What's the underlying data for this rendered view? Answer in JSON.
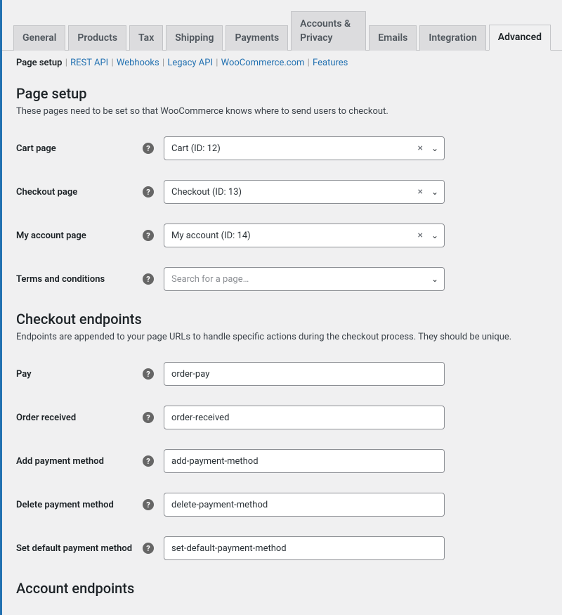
{
  "tabs": [
    {
      "label": "General",
      "active": false
    },
    {
      "label": "Products",
      "active": false
    },
    {
      "label": "Tax",
      "active": false
    },
    {
      "label": "Shipping",
      "active": false
    },
    {
      "label": "Payments",
      "active": false
    },
    {
      "label": "Accounts & Privacy",
      "active": false
    },
    {
      "label": "Emails",
      "active": false
    },
    {
      "label": "Integration",
      "active": false
    },
    {
      "label": "Advanced",
      "active": true
    }
  ],
  "subnav": [
    {
      "label": "Page setup",
      "current": true
    },
    {
      "label": "REST API",
      "current": false
    },
    {
      "label": "Webhooks",
      "current": false
    },
    {
      "label": "Legacy API",
      "current": false
    },
    {
      "label": "WooCommerce.com",
      "current": false
    },
    {
      "label": "Features",
      "current": false
    }
  ],
  "page_setup": {
    "heading": "Page setup",
    "description": "These pages need to be set so that WooCommerce knows where to send users to checkout.",
    "fields": {
      "cart": {
        "label": "Cart page",
        "value": "Cart (ID: 12)",
        "clearable": true
      },
      "checkout": {
        "label": "Checkout page",
        "value": "Checkout (ID: 13)",
        "clearable": true
      },
      "myaccount": {
        "label": "My account page",
        "value": "My account (ID: 14)",
        "clearable": true
      },
      "terms": {
        "label": "Terms and conditions",
        "placeholder": "Search for a page…",
        "clearable": false
      }
    }
  },
  "checkout_endpoints": {
    "heading": "Checkout endpoints",
    "description": "Endpoints are appended to your page URLs to handle specific actions during the checkout process. They should be unique.",
    "fields": {
      "pay": {
        "label": "Pay",
        "value": "order-pay"
      },
      "order_received": {
        "label": "Order received",
        "value": "order-received"
      },
      "add_pm": {
        "label": "Add payment method",
        "value": "add-payment-method"
      },
      "delete_pm": {
        "label": "Delete payment method",
        "value": "delete-payment-method"
      },
      "set_default_pm": {
        "label": "Set default payment method",
        "value": "set-default-payment-method"
      }
    }
  },
  "account_endpoints": {
    "heading": "Account endpoints"
  },
  "icons": {
    "help_glyph": "?",
    "clear_glyph": "×",
    "arrow_glyph": "⌄"
  }
}
